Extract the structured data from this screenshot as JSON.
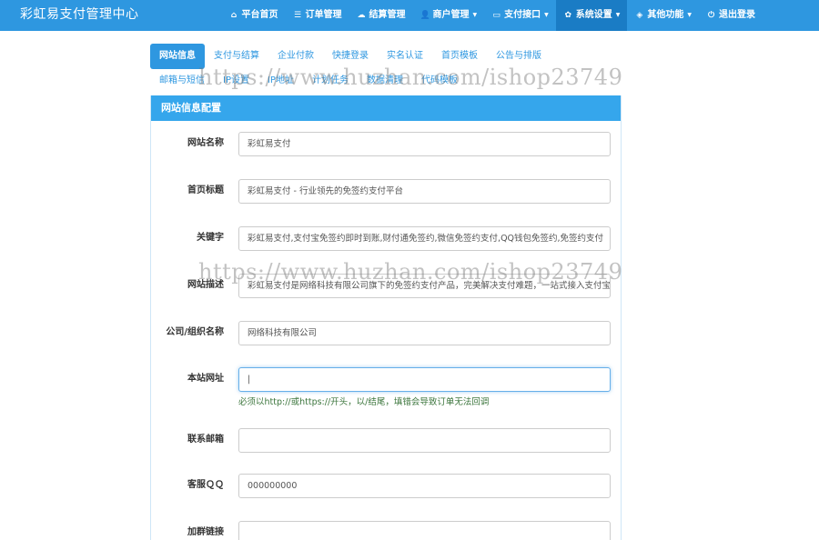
{
  "navbar": {
    "brand": "彩虹易支付管理中心",
    "items": [
      {
        "label": "平台首页",
        "icon": "home-icon",
        "glyph": "⌂",
        "dropdown": false,
        "active": false
      },
      {
        "label": "订单管理",
        "icon": "list-icon",
        "glyph": "☰",
        "dropdown": false,
        "active": false
      },
      {
        "label": "结算管理",
        "icon": "cloud-icon",
        "glyph": "☁",
        "dropdown": false,
        "active": false
      },
      {
        "label": "商户管理",
        "icon": "user-icon",
        "glyph": "👤",
        "dropdown": true,
        "active": false
      },
      {
        "label": "支付接口",
        "icon": "credit-card-icon",
        "glyph": "▭",
        "dropdown": true,
        "active": false
      },
      {
        "label": "系统设置",
        "icon": "gear-icon",
        "glyph": "✿",
        "dropdown": true,
        "active": true
      },
      {
        "label": "其他功能",
        "icon": "cube-icon",
        "glyph": "◈",
        "dropdown": true,
        "active": false
      },
      {
        "label": "退出登录",
        "icon": "power-icon",
        "glyph": "⏻",
        "dropdown": false,
        "active": false
      }
    ]
  },
  "tabs": {
    "row1": [
      "网站信息",
      "支付与结算",
      "企业付款",
      "快捷登录",
      "实名认证",
      "首页模板",
      "公告与排版"
    ],
    "row2": [
      "邮箱与短信",
      "IP设置",
      "IP地址",
      "计划任务",
      "数据清理",
      "代码模板"
    ],
    "active": "网站信息"
  },
  "panel": {
    "title": "网站信息配置"
  },
  "form": {
    "site_name": {
      "label": "网站名称",
      "value": "彩虹易支付"
    },
    "home_title": {
      "label": "首页标题",
      "value": "彩虹易支付 - 行业领先的免签约支付平台"
    },
    "keywords": {
      "label": "关键字",
      "value": "彩虹易支付,支付宝免签约即时到账,财付通免签约,微信免签约支付,QQ钱包免签约,免签约支付"
    },
    "description": {
      "label": "网站描述",
      "value": "彩虹易支付是网络科技有限公司旗下的免签约支付产品，完美解决支付难题，一站式接入支付宝，微信"
    },
    "company": {
      "label": "公司/组织名称",
      "value": "网络科技有限公司"
    },
    "site_url": {
      "label": "本站网址",
      "value": "|",
      "help": "必须以http://或https://开头，以/结尾，填错会导致订单无法回调"
    },
    "email": {
      "label": "联系邮箱",
      "value": ""
    },
    "qq": {
      "label": "客服ＱＱ",
      "value": "000000000"
    },
    "group_link": {
      "label": "加群链接",
      "value": ""
    }
  },
  "watermark": "https://www.huzhan.com/ishop23749"
}
